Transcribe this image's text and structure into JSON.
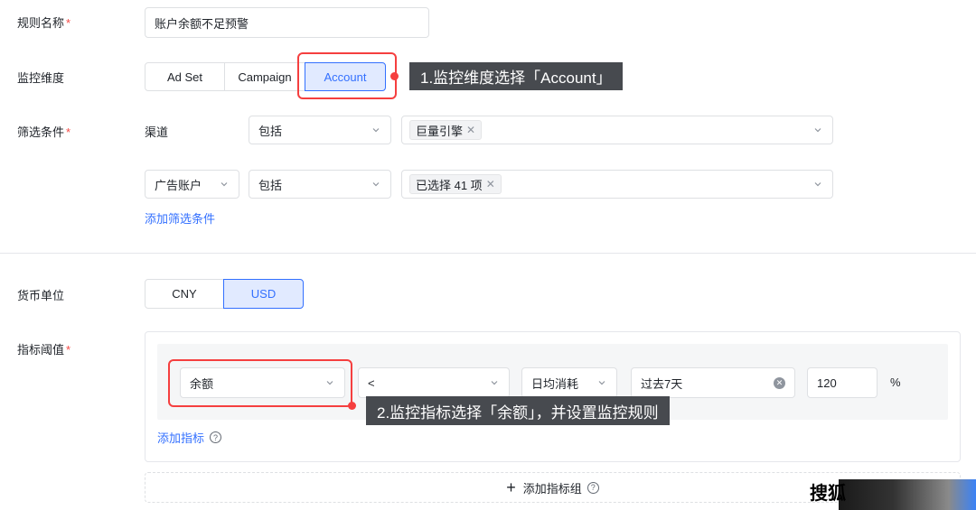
{
  "rule_name": {
    "label": "规则名称",
    "required": "*",
    "value": "账户余额不足预警"
  },
  "dimension": {
    "label": "监控维度",
    "options": [
      "Ad Set",
      "Campaign",
      "Account"
    ],
    "selected": "Account"
  },
  "filters": {
    "label": "筛选条件",
    "required": "*",
    "row1": {
      "field": "渠道",
      "operator": "包括",
      "tags": [
        "巨量引擎"
      ]
    },
    "row2": {
      "field": "广告账户",
      "operator": "包括",
      "tags": [
        "已选择 41 项"
      ]
    },
    "add_link": "添加筛选条件"
  },
  "currency": {
    "label": "货币单位",
    "options": [
      "CNY",
      "USD"
    ],
    "selected": "USD"
  },
  "threshold": {
    "label": "指标阈值",
    "required": "*",
    "metric": "余额",
    "comparator": "<",
    "aggregation": "日均消耗",
    "period": "过去7天",
    "value": "120",
    "unit": "%",
    "add_metric_link": "添加指标",
    "add_group": "添加指标组"
  },
  "annotations": {
    "tip1": "1.监控维度选择「Account」",
    "tip2": "2.监控指标选择「余额」，并设置监控规则"
  },
  "watermark": {
    "text": "搜狐"
  },
  "colors": {
    "accent": "#3370ff",
    "highlight_red": "#f53f3f",
    "tooltip_bg": "#474a4f"
  }
}
